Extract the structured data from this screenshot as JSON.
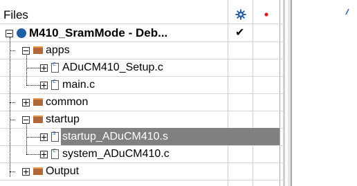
{
  "header": {
    "files_label": "Files",
    "gear_icon": "gear-icon",
    "red_dot_icon": "red-dot-icon"
  },
  "tree": {
    "project": {
      "label": "M410_SramMode - Deb...",
      "check": "✔"
    },
    "apps": {
      "label": "apps"
    },
    "setup_c": {
      "label": "ADuCM410_Setup.c"
    },
    "main_c": {
      "label": "main.c"
    },
    "common": {
      "label": "common"
    },
    "startup": {
      "label": "startup"
    },
    "startup_s": {
      "label": "startup_ADuCM410.s"
    },
    "system_c": {
      "label": "system_ADuCM410.c"
    },
    "output": {
      "label": "Output"
    }
  },
  "colors": {
    "selected_row_bg": "#808080",
    "gear_color": "#2a5fa8",
    "dot_color": "#e02020"
  }
}
